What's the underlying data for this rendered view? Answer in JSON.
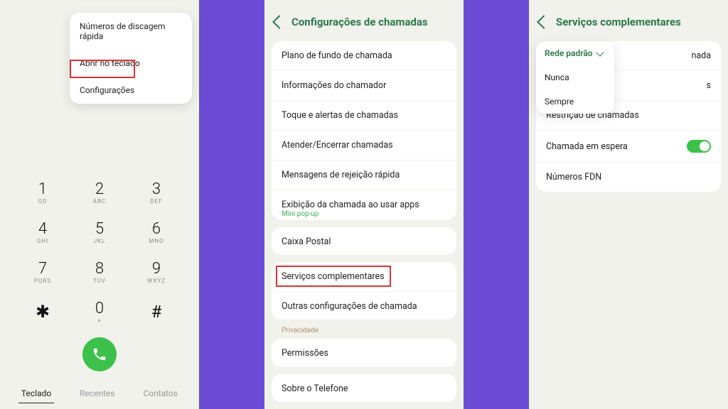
{
  "panel1": {
    "popup": {
      "items": [
        {
          "label": "Números de discagem rápida"
        },
        {
          "label": "Abrir no teclado"
        },
        {
          "label": "Configurações"
        }
      ]
    },
    "keys": [
      {
        "num": "1",
        "sub": "QD"
      },
      {
        "num": "2",
        "sub": "ABC"
      },
      {
        "num": "3",
        "sub": "DEF"
      },
      {
        "num": "4",
        "sub": "GHI"
      },
      {
        "num": "5",
        "sub": "JKL"
      },
      {
        "num": "6",
        "sub": "MNO"
      },
      {
        "num": "7",
        "sub": "PQRS"
      },
      {
        "num": "8",
        "sub": "TUV"
      },
      {
        "num": "9",
        "sub": "WXYZ"
      },
      {
        "num": "✱",
        "sub": ""
      },
      {
        "num": "0",
        "sub": "+"
      },
      {
        "num": "#",
        "sub": ""
      }
    ],
    "tabs": {
      "keypad": "Teclado",
      "recents": "Recentes",
      "contacts": "Contatos"
    }
  },
  "panel2": {
    "title": "Configurações de chamadas",
    "group1": [
      {
        "label": "Plano de fundo de chamada"
      },
      {
        "label": "Informações do chamador"
      },
      {
        "label": "Toque e alertas de chamadas"
      },
      {
        "label": "Atender/Encerrar chamadas"
      },
      {
        "label": "Mensagens de rejeição rápida"
      },
      {
        "label": "Exibição da chamada ao usar apps",
        "sub": "Mini pop-up"
      }
    ],
    "group2": [
      {
        "label": "Caixa Postal"
      }
    ],
    "group3": [
      {
        "label": "Serviços complementares"
      },
      {
        "label": "Outras configurações de chamada"
      }
    ],
    "privacy_label": "Privacidade",
    "group4": [
      {
        "label": "Permissões"
      }
    ],
    "group5": [
      {
        "label": "Sobre o Telefone"
      }
    ]
  },
  "panel3": {
    "title": "Serviços complementares",
    "rows": {
      "r0_partial": "nada",
      "r1_partial": "s",
      "r2": "Restrição de chamadas",
      "r3": "Chamada em espera",
      "r4": "Números FDN"
    },
    "popup": {
      "head": "Rede padrão",
      "items": [
        {
          "label": "Nunca"
        },
        {
          "label": "Sempre"
        }
      ]
    }
  }
}
